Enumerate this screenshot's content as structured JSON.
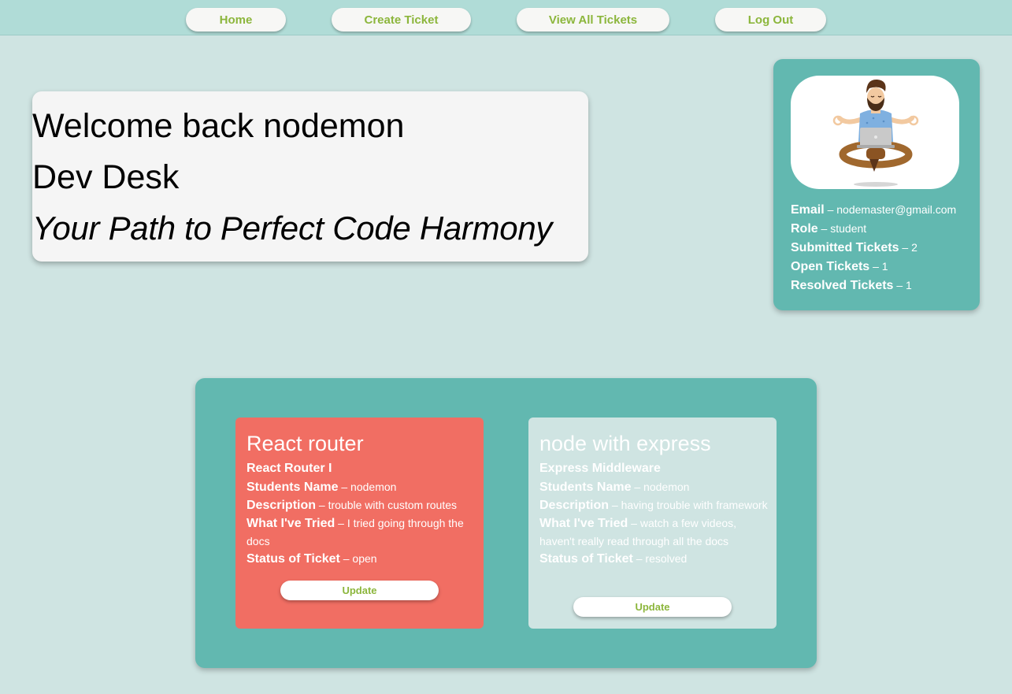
{
  "nav": {
    "home": "Home",
    "create_ticket": "Create Ticket",
    "view_all": "View All Tickets",
    "log_out": "Log Out"
  },
  "welcome": {
    "title": "Welcome back nodemon",
    "brand": "Dev Desk",
    "tagline": "Your Path to Perfect Code Harmony"
  },
  "profile": {
    "avatar_icon": "meditating-developer-illustration",
    "fields": [
      {
        "label": "Email",
        "sep": " – ",
        "value": "nodemaster@gmail.com"
      },
      {
        "label": "Role",
        "sep": " – ",
        "value": "student"
      },
      {
        "label": "Submitted Tickets",
        "sep": " – ",
        "value": "2"
      },
      {
        "label": "Open Tickets",
        "sep": " – ",
        "value": "1"
      },
      {
        "label": "Resolved Tickets",
        "sep": " – ",
        "value": "1"
      }
    ]
  },
  "tickets": [
    {
      "title": "React router",
      "category": "React Router I",
      "students_name_label": "Students Name",
      "students_name": "nodemon",
      "description_label": "Description",
      "description": "trouble with custom routes",
      "tried_label": "What I've Tried",
      "tried": "I tried going through the docs",
      "status_label": "Status of Ticket",
      "status": "open",
      "update_label": "Update",
      "card_color": "#f16e63"
    },
    {
      "title": "node with express",
      "category": "Express Middleware",
      "students_name_label": "Students Name",
      "students_name": "nodemon",
      "description_label": "Description",
      "description": "having trouble with framework",
      "tried_label": "What I've Tried",
      "tried": "watch a few videos, haven't really read through all the docs",
      "status_label": "Status of Ticket",
      "status": "resolved",
      "update_label": "Update",
      "card_color": "#cfe4e2"
    }
  ],
  "colors": {
    "background": "#cfe4e2",
    "navbar": "#b0dcd7",
    "accent_teal": "#62b8b0",
    "button_text_green": "#8cb63c",
    "open_ticket": "#f16e63"
  }
}
